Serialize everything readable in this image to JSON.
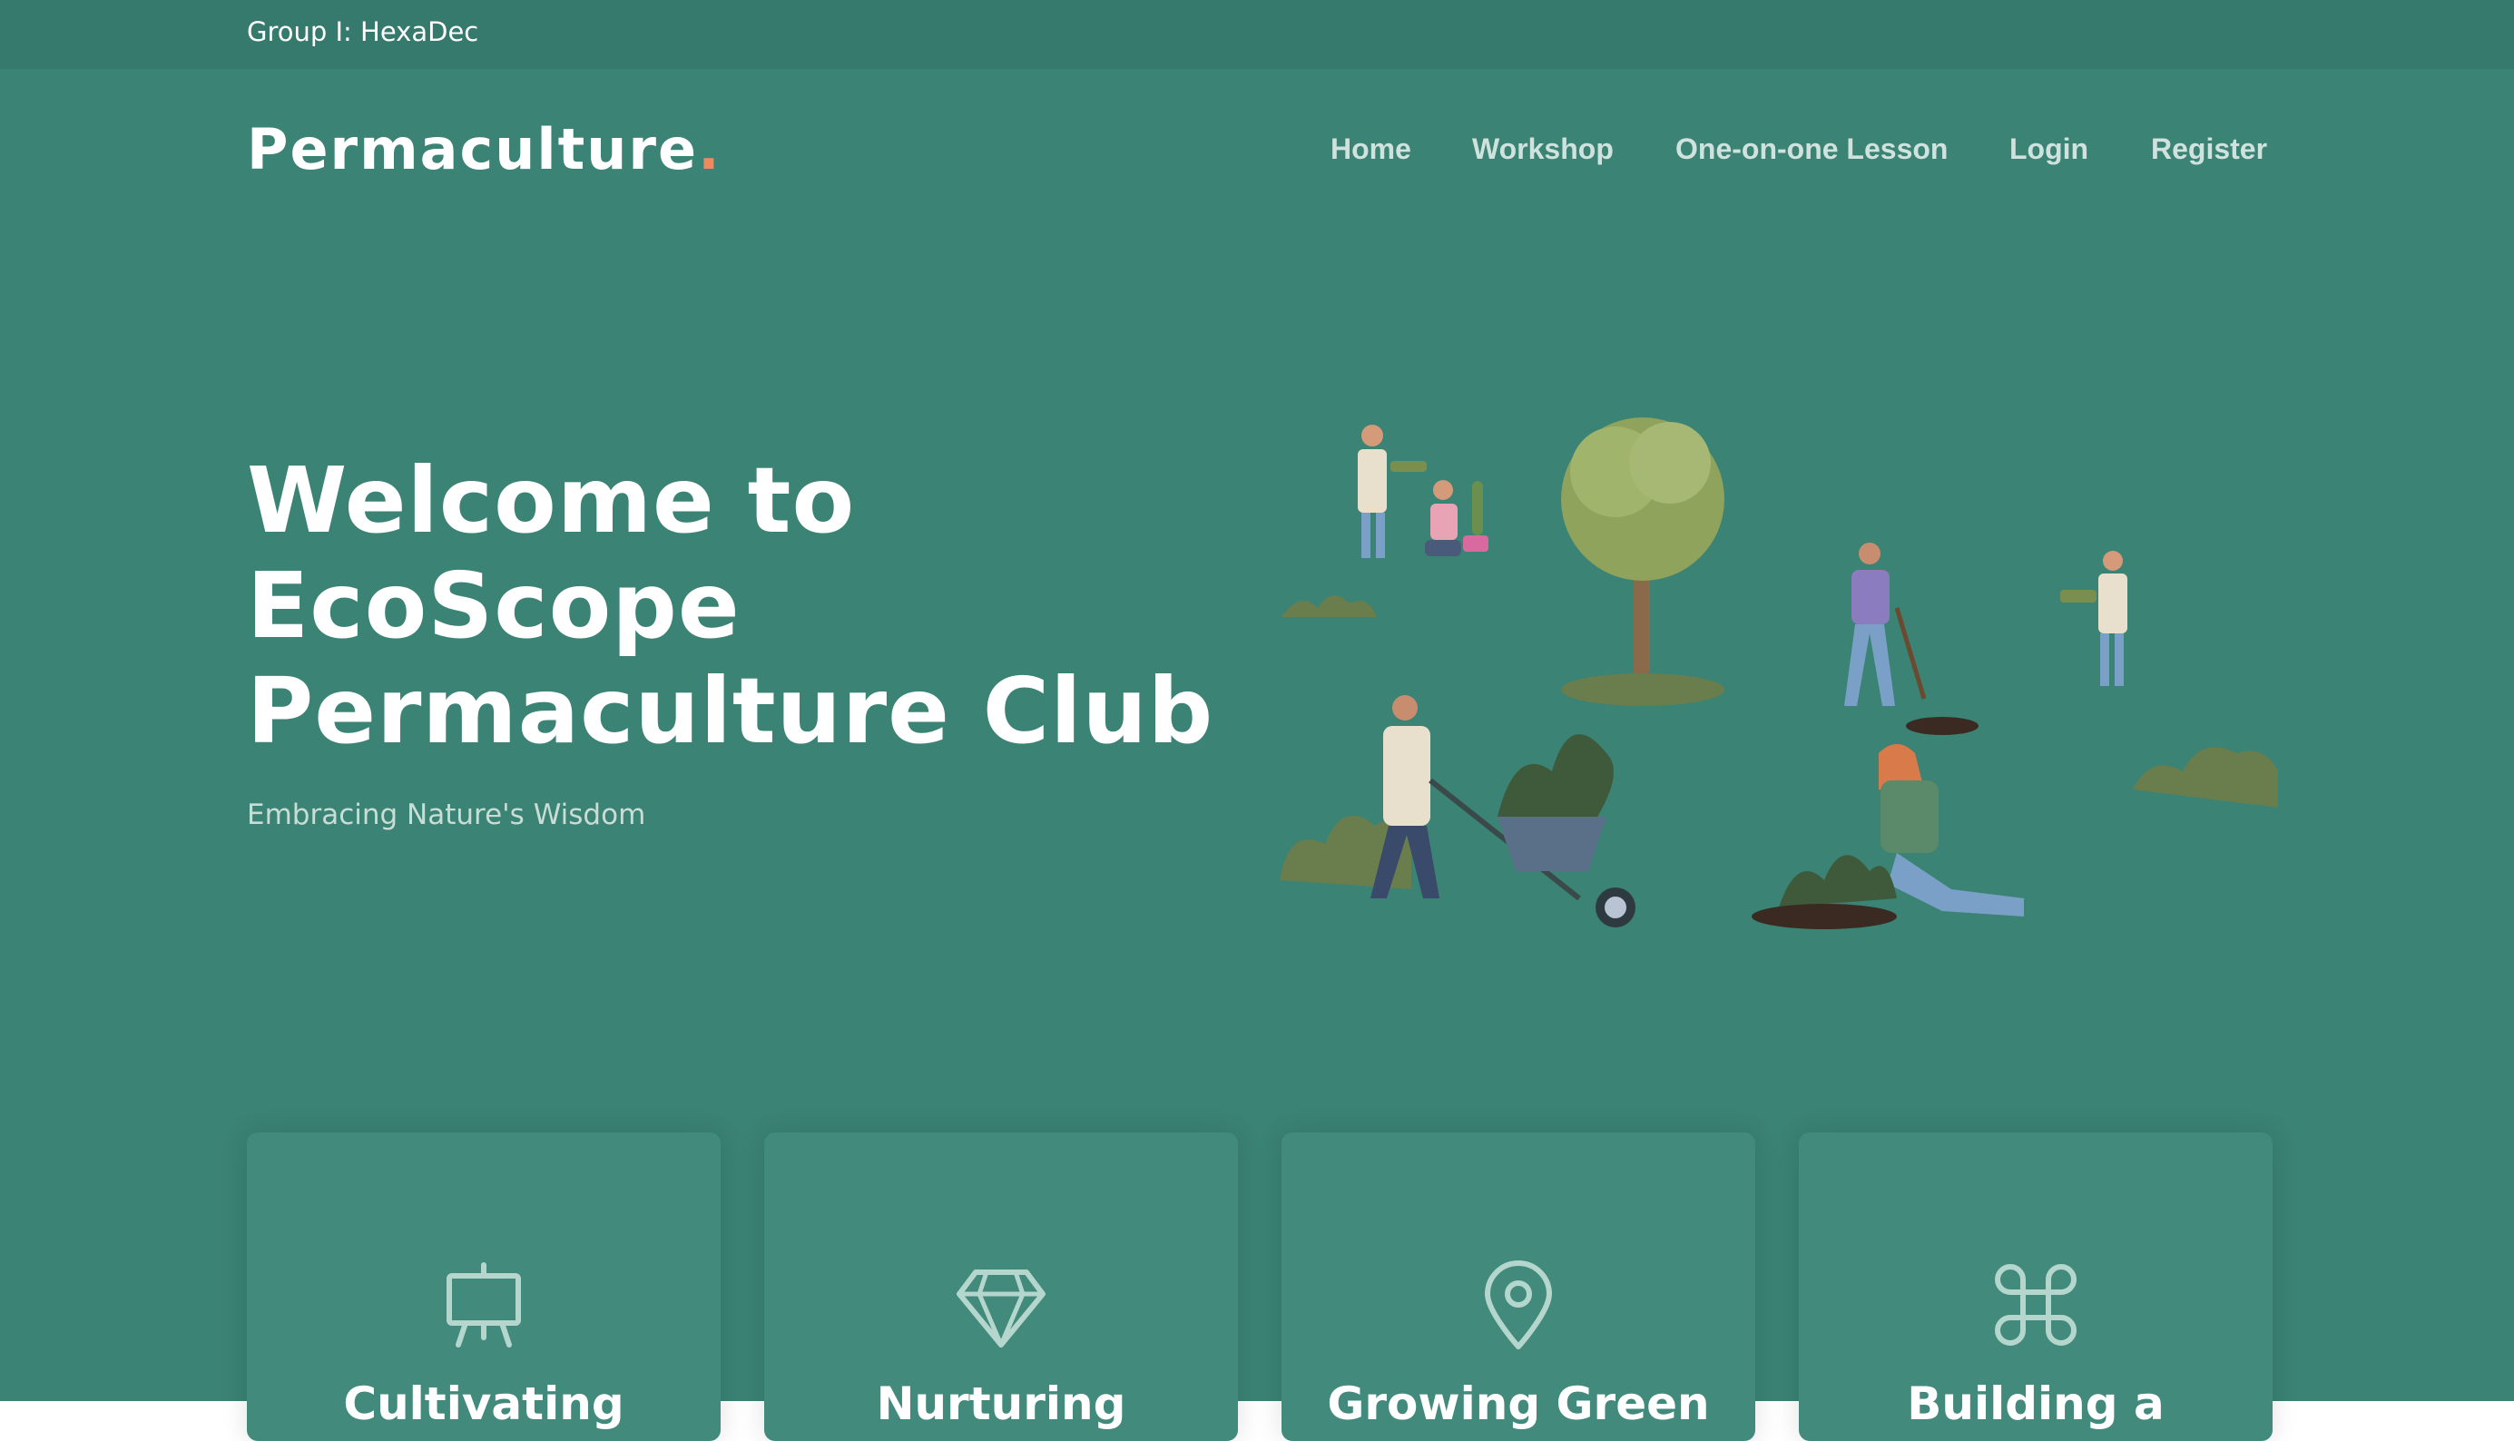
{
  "topbar": {
    "text": "Group I: HexaDec"
  },
  "brand": {
    "name": "Permaculture",
    "dot": ".",
    "dot_color": "#f08a5d"
  },
  "nav": {
    "items": [
      {
        "label": "Home"
      },
      {
        "label": "Workshop"
      },
      {
        "label": "One-on-one Lesson"
      },
      {
        "label": "Login"
      },
      {
        "label": "Register"
      }
    ]
  },
  "hero": {
    "title_lines": [
      "Welcome to",
      "EcoScope",
      "Permaculture Club"
    ],
    "subtitle": "Embracing Nature's Wisdom"
  },
  "features": [
    {
      "icon": "easel-icon",
      "title": "Cultivating"
    },
    {
      "icon": "diamond-icon",
      "title": "Nurturing"
    },
    {
      "icon": "map-pin-icon",
      "title": "Growing Green"
    },
    {
      "icon": "command-icon",
      "title": "Building a"
    }
  ],
  "colors": {
    "topbar": "#357a6d",
    "hero": "#3b8374",
    "card": "#428b7c",
    "nav_text": "#cfe2dd"
  }
}
